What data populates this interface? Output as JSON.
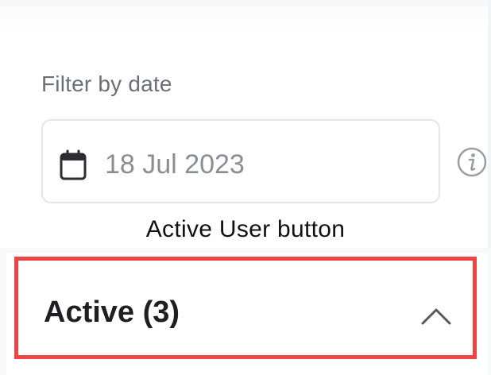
{
  "filter": {
    "label": "Filter by date",
    "date_value": "18 Jul 2023",
    "calendar_icon": "calendar-icon",
    "info_icon": "info-icon"
  },
  "annotation": {
    "text": "Active User button"
  },
  "active_section": {
    "label": "Active (3)",
    "toggle_icon": "chevron-up-icon",
    "highlight_color": "#ef4444"
  }
}
